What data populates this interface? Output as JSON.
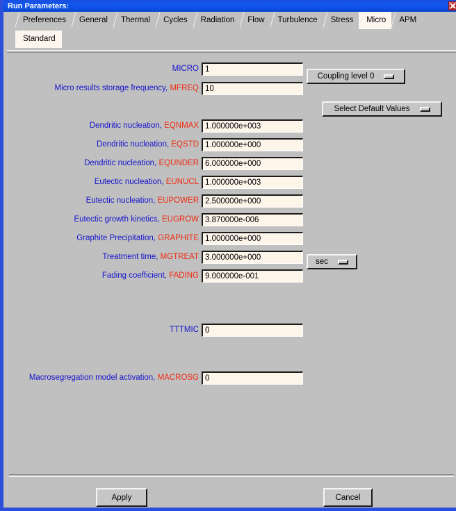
{
  "window": {
    "title": "Run Parameters:",
    "close_icon": "close-icon",
    "border_color": "#2b4fd8",
    "titlebar_color": "#1057ef",
    "face_color": "#c0c0c0",
    "field_color": "#fdf4ea",
    "label_desc_color": "#1414cc",
    "label_var_color": "#ee2b11"
  },
  "tabs": {
    "row1": [
      {
        "label": "Preferences",
        "active": false
      },
      {
        "label": "General",
        "active": false
      },
      {
        "label": "Thermal",
        "active": false
      },
      {
        "label": "Cycles",
        "active": false
      },
      {
        "label": "Radiation",
        "active": false
      },
      {
        "label": "Flow",
        "active": false
      },
      {
        "label": "Turbulence",
        "active": false
      },
      {
        "label": "Stress",
        "active": false
      },
      {
        "label": "Micro",
        "active": true
      },
      {
        "label": "APM",
        "active": false
      }
    ],
    "row2": [
      {
        "label": "Standard",
        "active": true
      }
    ]
  },
  "form": {
    "rows": [
      {
        "desc": "",
        "var": "MICRO",
        "var_color": "blue",
        "value": "1"
      },
      {
        "desc": "Micro results storage frequency,",
        "var": "MFREQ",
        "var_color": "red",
        "value": "10"
      },
      {
        "desc": "Dendritic nucleation,",
        "var": "EQNMAX",
        "var_color": "red",
        "value": "1.000000e+003"
      },
      {
        "desc": "Dendritic nucleation,",
        "var": "EQSTD",
        "var_color": "red",
        "value": "1.000000e+000"
      },
      {
        "desc": "Dendritic nucleation,",
        "var": "EQUNDER",
        "var_color": "red",
        "value": "6.000000e+000"
      },
      {
        "desc": "Eutectic nucleation,",
        "var": "EUNUCL",
        "var_color": "red",
        "value": "1.000000e+003"
      },
      {
        "desc": "Eutectic nucleation,",
        "var": "EUPOWER",
        "var_color": "red",
        "value": "2.500000e+000"
      },
      {
        "desc": "Eutectic growth kinetics,",
        "var": "EUGROW",
        "var_color": "red",
        "value": "3.870000e-006"
      },
      {
        "desc": "Graphite Precipitation,",
        "var": "GRAPHITE",
        "var_color": "red",
        "value": "1.000000e+000"
      },
      {
        "desc": "Treatment time,",
        "var": "MGTREAT",
        "var_color": "red",
        "value": "3.000000e+000"
      },
      {
        "desc": "Fading coefficient,",
        "var": "FADING",
        "var_color": "red",
        "value": "9.000000e-001"
      },
      {
        "desc": "",
        "var": "TTTMIC",
        "var_color": "blue",
        "value": "0"
      },
      {
        "desc": "Macrosegregation model activation,",
        "var": "MACROSG",
        "var_color": "red",
        "value": "0"
      }
    ]
  },
  "option_menus": {
    "coupling_level": "Coupling level 0",
    "select_defaults": "Select Default Values",
    "treatment_time_units": "sec"
  },
  "footer": {
    "apply_label": "Apply",
    "cancel_label": "Cancel"
  }
}
